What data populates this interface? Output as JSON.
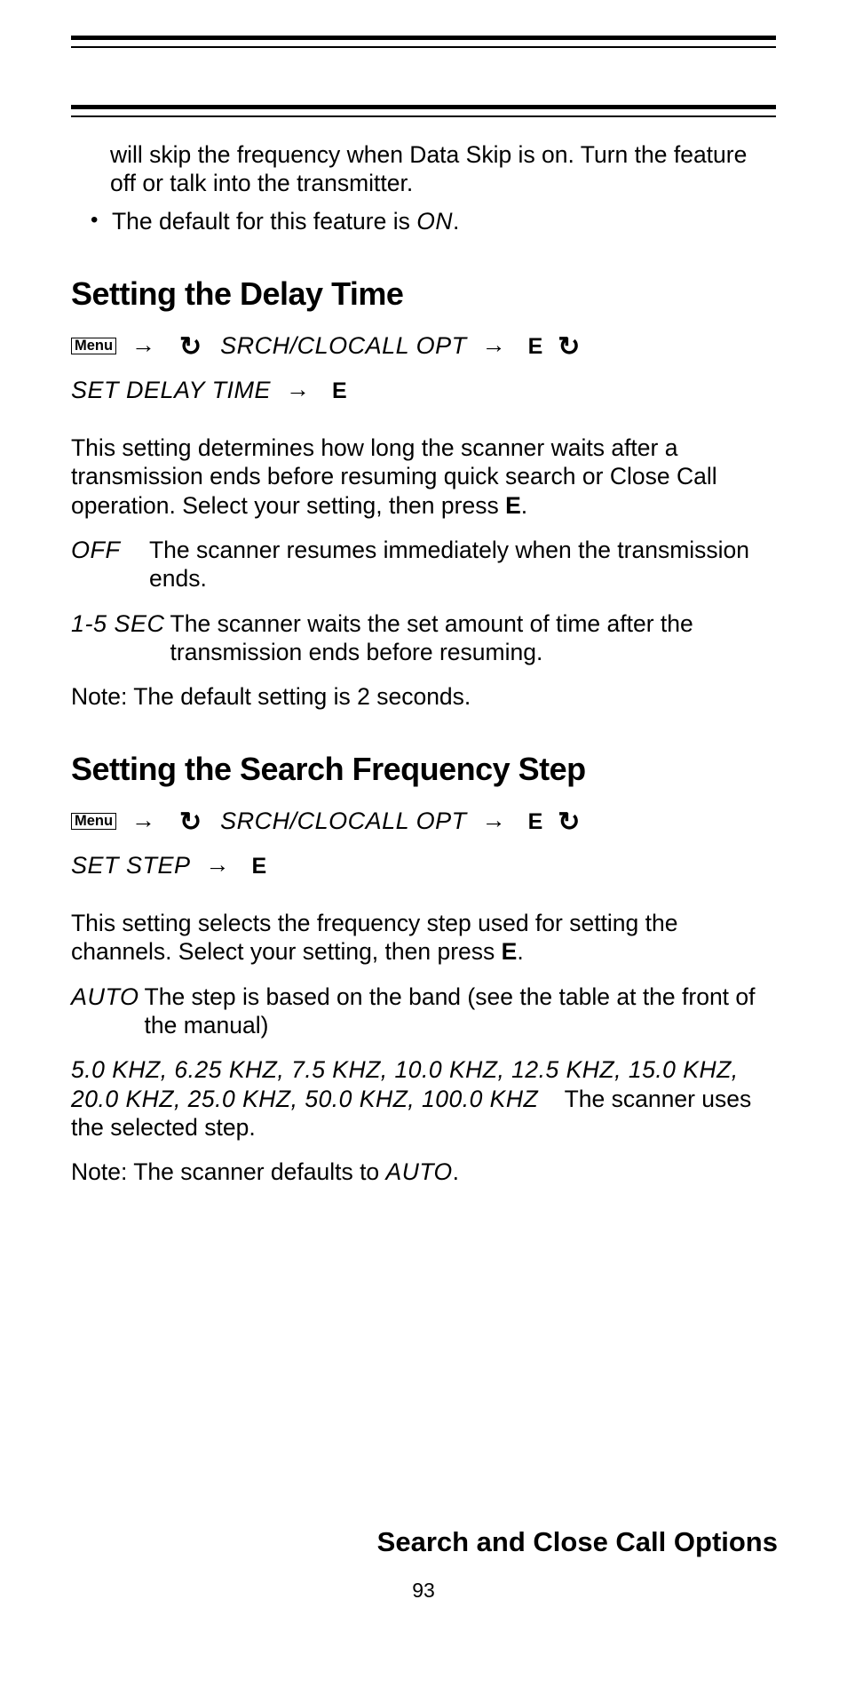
{
  "continuation_text": "will skip the frequency when Data Skip is on. Turn the feature off or talk into the transmitter.",
  "bullet1_pre": "The default for this feature is ",
  "bullet1_lcd": "ON",
  "bullet1_post": ".",
  "menu_label": "Menu",
  "arrow_glyph": "→",
  "rotate_glyph": "↻",
  "key_e": "E",
  "delay": {
    "heading": "Setting the Delay Time",
    "nav_opt": "SRCH/CLOCALL OPT",
    "nav_setting": "SET DELAY TIME",
    "intro_pre": "This setting determines how long the scanner waits after a transmission ends before resuming quick search or Close Call operation. Select your setting, then press ",
    "intro_post": ".",
    "off_term": "OFF",
    "off_desc": "The scanner resumes immediately when the transmission ends.",
    "sec_term": "1-5 SEC",
    "sec_desc": "The scanner waits the set amount of time after the transmission ends before resuming.",
    "note": "Note: The default setting is 2 seconds."
  },
  "step": {
    "heading": "Setting the Search Frequency Step",
    "nav_opt": "SRCH/CLOCALL OPT",
    "nav_setting": "SET STEP",
    "intro_pre": "This setting selects the frequency step used for setting the channels. Select your setting, then press ",
    "intro_post": ".",
    "auto_term": "AUTO",
    "auto_desc": "The step is based on the band (see the table at the front of the manual)",
    "steps_list": "5.0 KHZ, 6.25 KHZ, 7.5 KHZ, 10.0 KHZ, 12.5 KHZ, 15.0 KHZ, 20.0 KHZ, 25.0 KHZ, 50.0 KHZ, 100.0 KHZ",
    "steps_post": "The scanner uses the selected step.",
    "note_pre": "Note: The scanner defaults to ",
    "note_lcd": "AUTO",
    "note_post": "."
  },
  "footer_title": "Search and Close Call Options",
  "page_number": "93"
}
